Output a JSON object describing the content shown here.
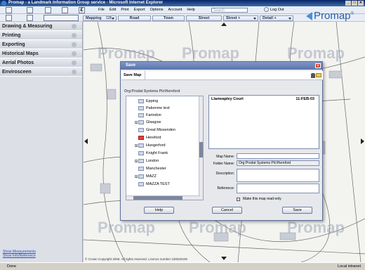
{
  "window": {
    "title": "Promap - a Landmark Information Group service - Microsoft Internet Explorer",
    "controls": [
      "_",
      "□",
      "✕"
    ]
  },
  "toolbar": {
    "menu": [
      "File",
      "Edit",
      "Print",
      "Export",
      "Options",
      "Account",
      "Help"
    ],
    "search_placeholder": "Search",
    "logout_label": "Log Out"
  },
  "navbar": {
    "mapping_label": "Mapping",
    "mapping_value": "GB",
    "road_label": "Road",
    "town_label": "Town",
    "street_label": "Street",
    "street2_label": "Street +",
    "detail_label": "Detail +"
  },
  "brand": {
    "logo_text": "Promap",
    "trademark": "®",
    "accent": "#2b5fa8"
  },
  "sidebar": {
    "items": [
      {
        "label": "Drawing & Measuring"
      },
      {
        "label": "Printing"
      },
      {
        "label": "Exporting"
      },
      {
        "label": "Historical Maps"
      },
      {
        "label": "Aerial Photos"
      },
      {
        "label": "Envirosceen"
      }
    ],
    "footer_links": [
      "Show Measurements",
      "Show Info/Reference"
    ]
  },
  "map": {
    "watermark": "Promap",
    "copyright": "© Crown Copyright 2006. All rights reserved. Licence number 100020449"
  },
  "dialog": {
    "title": "Save",
    "tab_label": "Save Map",
    "path": "Org:Prodat Systems Plc\\Hereford",
    "folders": [
      {
        "label": "Epping",
        "selected": false
      },
      {
        "label": "Pakenme test",
        "selected": false
      },
      {
        "label": "Farindon",
        "selected": false
      },
      {
        "label": "Glasgow",
        "selected": false
      },
      {
        "label": "Great Missenden",
        "selected": false
      },
      {
        "label": "Hereford",
        "selected": true
      },
      {
        "label": "Hungerford",
        "selected": false
      },
      {
        "label": "Knight Frank",
        "selected": false
      },
      {
        "label": "London",
        "selected": false
      },
      {
        "label": "Manchester",
        "selected": false
      },
      {
        "label": "MAZZ",
        "selected": false
      },
      {
        "label": "MAZZA TEST",
        "selected": false
      }
    ],
    "maps": [
      {
        "name": "Llanwapley Court",
        "date": "11-FEB-03"
      }
    ],
    "fields": {
      "map_name_label": "Map Name:",
      "map_name_value": "",
      "folder_name_label": "Folder Name:",
      "folder_name_value": "Org:Prodat Systems Plc\\Hereford",
      "description_label": "Description:",
      "description_value": "",
      "reference_label": "Reference:",
      "reference_value": "",
      "readonly_label": "Make this map read-only",
      "readonly_checked": false
    },
    "buttons": {
      "help": "Help",
      "cancel": "Cancel",
      "save": "Save"
    }
  },
  "statusbar": {
    "left": "Done",
    "zone": "Local intranet"
  }
}
